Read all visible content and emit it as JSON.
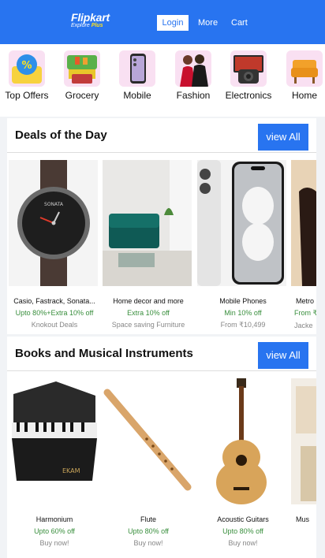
{
  "header": {
    "logo": "Flipkart",
    "tagline": "Explore",
    "tagline_plus": "Plus",
    "login": "Login",
    "more": "More",
    "cart": "Cart",
    "colors": {
      "brand": "#2874f0",
      "accent": "#ffe11b"
    }
  },
  "categories": [
    {
      "label": "Top Offers",
      "icon": "offer-icon"
    },
    {
      "label": "Grocery",
      "icon": "grocery-icon"
    },
    {
      "label": "Mobile",
      "icon": "mobile-icon"
    },
    {
      "label": "Fashion",
      "icon": "fashion-icon"
    },
    {
      "label": "Electronics",
      "icon": "electronics-icon"
    },
    {
      "label": "Home",
      "icon": "home-icon"
    }
  ],
  "sections": [
    {
      "title": "Deals of the Day",
      "view_all": "view All",
      "items": [
        {
          "name": "Casio, Fastrack, Sonata...",
          "offer": "Upto 80%+Extra 10% off",
          "sub": "Knokout Deals"
        },
        {
          "name": "Home decor and more",
          "offer": "Extra 10% off",
          "sub": "Space saving Furniture"
        },
        {
          "name": "Mobile Phones",
          "offer": "Min 10% off",
          "sub": "From ₹10,499"
        },
        {
          "name": "Metro",
          "offer": "From ₹",
          "sub": "Jacke"
        }
      ]
    },
    {
      "title": "Books and Musical Instruments",
      "view_all": "view All",
      "items": [
        {
          "name": "Harmonium",
          "offer": "Upto 60% off",
          "sub": "Buy now!"
        },
        {
          "name": "Flute",
          "offer": "Upto 80% off",
          "sub": "Buy now!"
        },
        {
          "name": "Acoustic Guitars",
          "offer": "Upto 80% off",
          "sub": "Buy now!"
        },
        {
          "name": "Mus",
          "offer": "",
          "sub": ""
        }
      ]
    }
  ]
}
